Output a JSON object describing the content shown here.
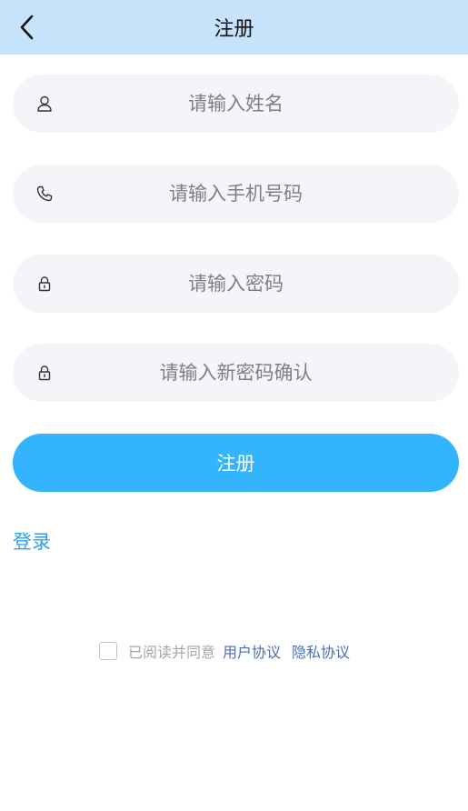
{
  "header": {
    "title": "注册",
    "back_icon": "chevron-left-icon"
  },
  "form": {
    "name_placeholder": "请输入姓名",
    "phone_placeholder": "请输入手机号码",
    "password_placeholder": "请输入密码",
    "confirm_placeholder": "请输入新密码确认",
    "icons": [
      "user-icon",
      "phone-icon",
      "lock-icon",
      "lock-icon"
    ]
  },
  "submit_label": "注册",
  "login_link": "登录",
  "agreement": {
    "checked": false,
    "prefix": "已阅读并同意",
    "user_agreement": "用户协议",
    "privacy_agreement": "隐私协议"
  },
  "colors": {
    "header_bg": "#c7e2fb",
    "accent": "#35b4fe",
    "link": "#2d9ff0",
    "agreement_link": "#4a6fb5",
    "field_bg": "#f4f5f8"
  }
}
